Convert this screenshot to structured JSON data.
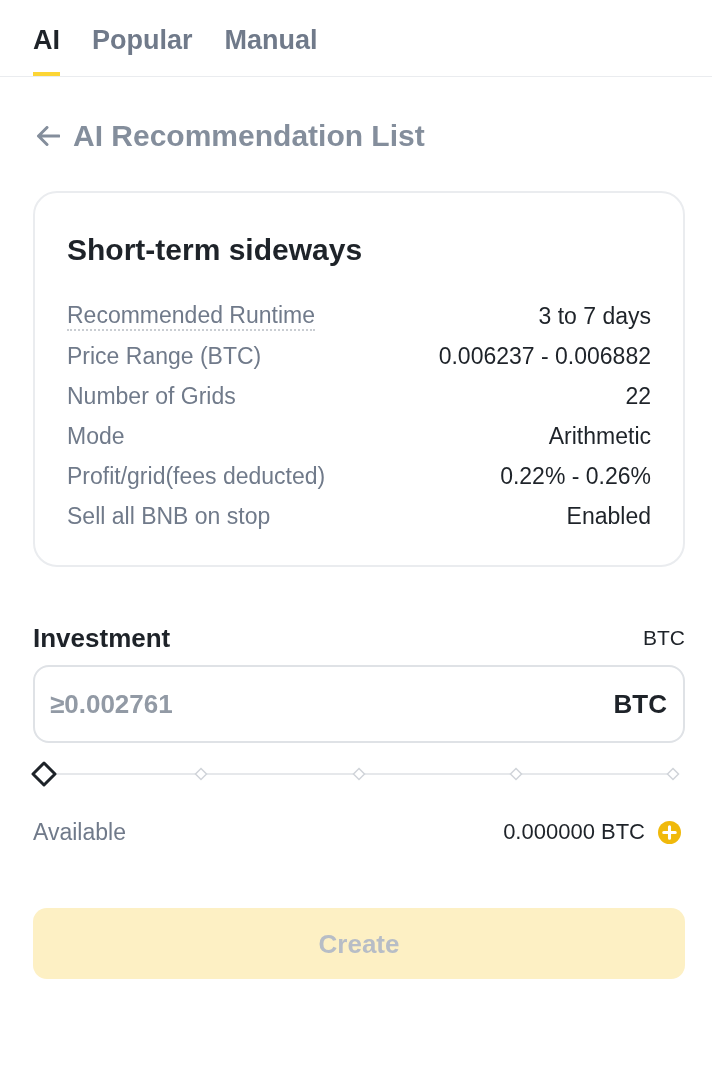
{
  "tabs": [
    {
      "label": "AI",
      "selected": true
    },
    {
      "label": "Popular",
      "selected": false
    },
    {
      "label": "Manual",
      "selected": false
    }
  ],
  "header": {
    "title": "AI Recommendation List"
  },
  "strategy_card": {
    "title": "Short-term sideways",
    "rows": [
      {
        "kind": "hint",
        "label": "Recommended Runtime",
        "value": "3 to 7 days"
      },
      {
        "kind": "plain",
        "label": "Price Range (BTC)",
        "value": "0.006237 - 0.006882"
      },
      {
        "kind": "plain",
        "label": "Number of Grids",
        "value": "22"
      },
      {
        "kind": "plain",
        "label": "Mode",
        "value": "Arithmetic"
      },
      {
        "kind": "plain",
        "label": "Profit/grid(fees deducted)",
        "value": "0.22% - 0.26%"
      },
      {
        "kind": "plain",
        "label": "Sell all BNB on stop",
        "value": "Enabled"
      }
    ]
  },
  "investment": {
    "label": "Investment",
    "unit": "BTC",
    "input": {
      "placeholder": "≥0.002761",
      "unit": "BTC"
    },
    "slider": {
      "level": 0
    },
    "available": {
      "label": "Available",
      "value": "0.000000 BTC"
    }
  },
  "create_button": {
    "label": "Create",
    "disabled": true
  }
}
